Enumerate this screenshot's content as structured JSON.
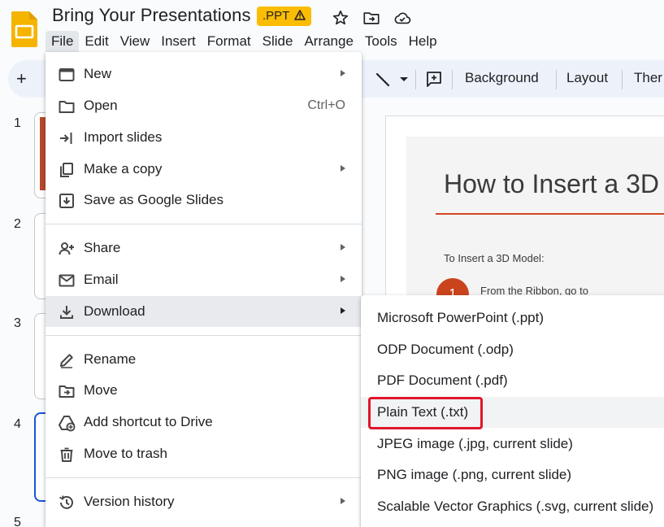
{
  "app": {
    "doc_title": "Bring Your Presentations",
    "badge": ".PPT",
    "colors": {
      "accent_yellow": "#fbbc04",
      "selection_blue": "#1a57d6",
      "highlight_red": "#e0162b",
      "slide_accent": "#d24726"
    }
  },
  "menubar": {
    "items": [
      "File",
      "Edit",
      "View",
      "Insert",
      "Format",
      "Slide",
      "Arrange",
      "Tools",
      "Help"
    ],
    "active": "File"
  },
  "toolbar": {
    "background": "Background",
    "layout": "Layout",
    "theme": "Ther"
  },
  "slides": {
    "numbers": [
      "1",
      "2",
      "3",
      "4",
      "5"
    ],
    "selected": "4"
  },
  "slide": {
    "heading": "How to Insert a 3D",
    "subheading": "To Insert a 3D Model:",
    "step_number": "1",
    "step_text": "From the Ribbon, go to"
  },
  "file_menu": {
    "new": "New",
    "open": "Open",
    "open_shortcut": "Ctrl+O",
    "import_slides": "Import slides",
    "make_copy": "Make a copy",
    "save_as": "Save as Google Slides",
    "share": "Share",
    "email": "Email",
    "download": "Download",
    "rename": "Rename",
    "move": "Move",
    "add_shortcut": "Add shortcut to Drive",
    "move_to_trash": "Move to trash",
    "version_history": "Version history"
  },
  "download_menu": {
    "items": [
      "Microsoft PowerPoint (.ppt)",
      "ODP Document (.odp)",
      "PDF Document (.pdf)",
      "Plain Text (.txt)",
      "JPEG image (.jpg, current slide)",
      "PNG image (.png, current slide)",
      "Scalable Vector Graphics (.svg, current slide)"
    ],
    "highlighted": "Plain Text (.txt)"
  }
}
